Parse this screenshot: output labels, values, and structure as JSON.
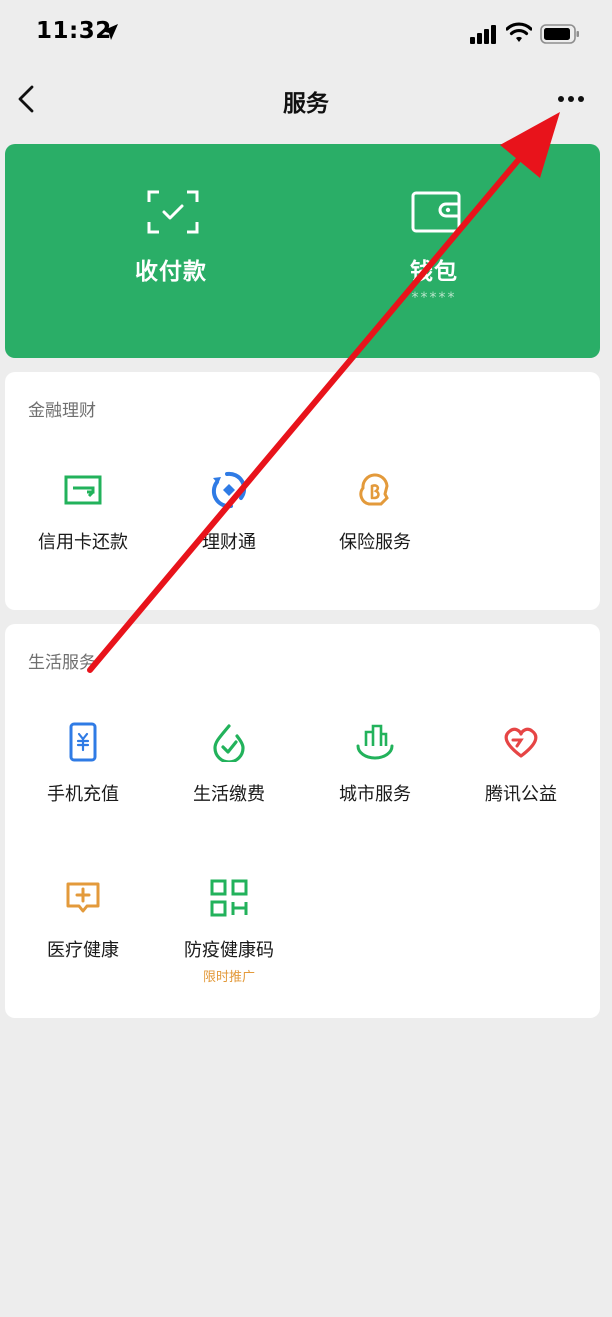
{
  "status_bar": {
    "time": "11:32"
  },
  "nav": {
    "title": "服务"
  },
  "wallet_card": {
    "pay": {
      "label": "收付款"
    },
    "wallet": {
      "label": "钱包",
      "balance_masked": "*****"
    }
  },
  "finance": {
    "title": "金融理财",
    "items": [
      {
        "label": "信用卡还款",
        "icon": "credit-card-icon"
      },
      {
        "label": "理财通",
        "icon": "wealth-icon"
      },
      {
        "label": "保险服务",
        "icon": "insurance-icon"
      }
    ]
  },
  "life": {
    "title": "生活服务",
    "items": [
      {
        "label": "手机充值",
        "icon": "phone-topup-icon"
      },
      {
        "label": "生活缴费",
        "icon": "utility-bill-icon"
      },
      {
        "label": "城市服务",
        "icon": "city-service-icon"
      },
      {
        "label": "腾讯公益",
        "icon": "charity-icon"
      },
      {
        "label": "医疗健康",
        "icon": "medical-icon"
      },
      {
        "label": "防疫健康码",
        "icon": "qr-code-icon",
        "badge": "限时推广"
      }
    ]
  },
  "colors": {
    "brand_green": "#2aae67",
    "background": "#ededed",
    "orange": "#e39a3b",
    "blue": "#2f7be5",
    "red": "#e64545",
    "annotation_arrow": "#e8131b"
  }
}
